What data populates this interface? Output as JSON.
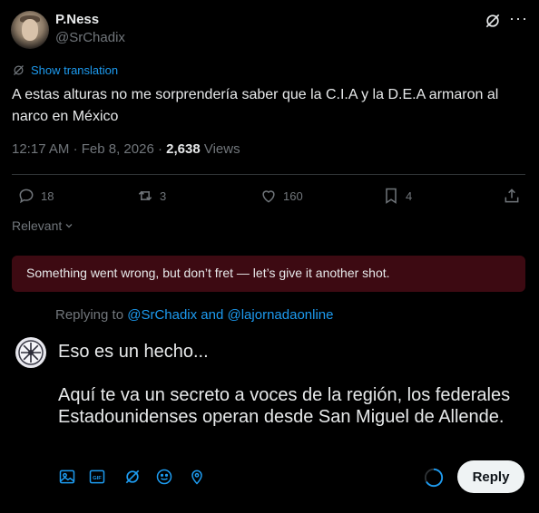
{
  "post": {
    "author_name": "P.Ness",
    "author_handle": "@SrChadix",
    "translate_label": "Show translation",
    "text": "A estas alturas no me sorprendería saber que la C.I.A y la D.E.A armaron al narco en México",
    "time": "12:17 AM",
    "date": "Feb 8, 2026",
    "views_count": "2,638",
    "views_label": "Views"
  },
  "actions": {
    "replies": "18",
    "reposts": "3",
    "likes": "160",
    "bookmarks": "4"
  },
  "sort": {
    "label": "Relevant"
  },
  "error": {
    "message": "Something went wrong, but don’t fret — let’s give it another shot."
  },
  "reply": {
    "replying_prefix": "Replying to",
    "replying_to": "@SrChadix and @lajornadaonline",
    "draft_text": "Eso es un hecho...\n\nAquí te va un secreto a voces de la región, los federales Estadounidenses operan desde San Miguel de Allende.",
    "button_label": "Reply"
  },
  "icons": {
    "grok": "grok-icon",
    "more": "more-icon",
    "reply": "reply-icon",
    "repost": "repost-icon",
    "like": "heart-icon",
    "bookmark": "bookmark-icon",
    "share": "share-icon",
    "media": "image-icon",
    "gif": "gif-icon",
    "grok_tool": "grok-icon",
    "emoji": "emoji-icon",
    "location": "location-icon"
  },
  "colors": {
    "background": "#000000",
    "accent": "#1d9bf0",
    "error_bg": "#3d0a12",
    "muted": "#71767b"
  }
}
